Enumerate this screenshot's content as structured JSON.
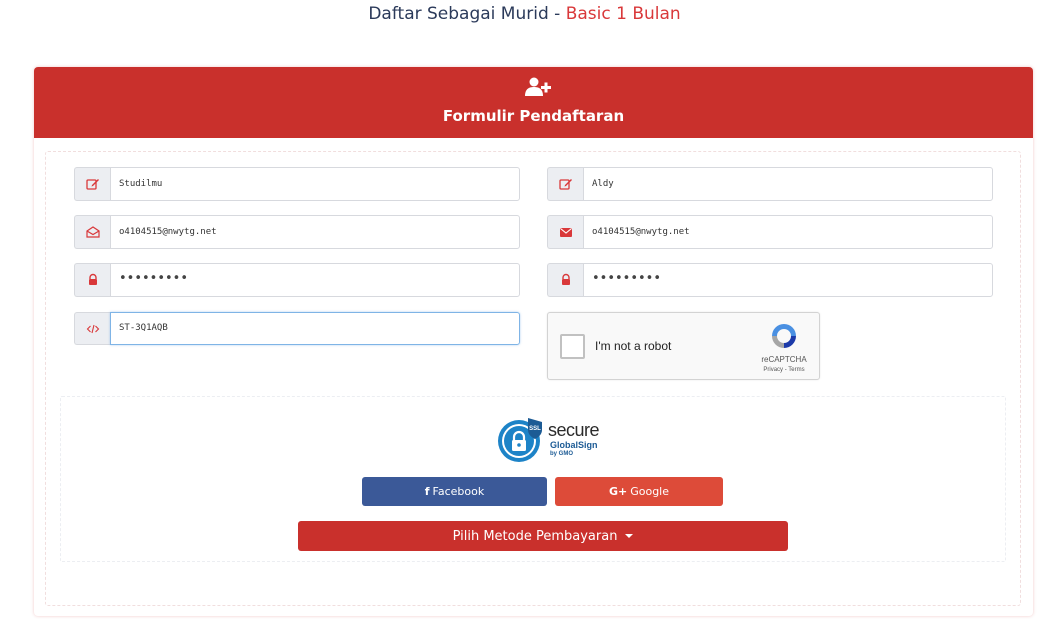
{
  "page": {
    "title_prefix": "Daftar Sebagai Murid - ",
    "title_plan": "Basic 1 Bulan"
  },
  "form": {
    "header_title": "Formulir Pendaftaran",
    "fields": {
      "first_name": "Studilmu",
      "last_name": "Aldy",
      "email": "o4104515@nwytg.net",
      "email_confirm": "o4104515@nwytg.net",
      "password": "•••••••••",
      "password_confirm": "•••••••••",
      "referral_code": "ST-3Q1AQB"
    },
    "recaptcha": {
      "label": "I'm not a robot",
      "brand": "reCAPTCHA",
      "terms": "Privacy - Terms"
    }
  },
  "badge": {
    "ssl": "SSL",
    "secure": "secure",
    "globalsign": "GlobalSign",
    "gmo": "by GMO"
  },
  "buttons": {
    "facebook": "Facebook",
    "google": "Google",
    "payment": "Pilih Metode Pembayaran"
  },
  "colors": {
    "accent": "#c9302c",
    "facebook": "#3b5998",
    "google": "#dd4b39",
    "title_text": "#2b3a5a"
  }
}
